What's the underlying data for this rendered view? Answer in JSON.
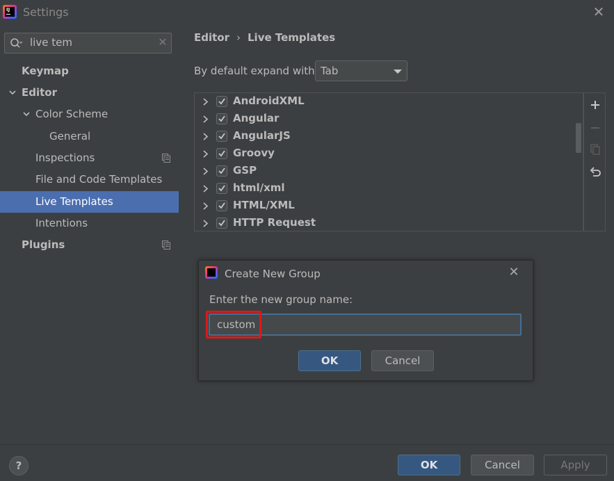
{
  "window": {
    "title": "Settings"
  },
  "search": {
    "value": "live tem"
  },
  "sidebar": {
    "items": [
      {
        "label": "Keymap"
      },
      {
        "label": "Editor"
      },
      {
        "label": "Color Scheme"
      },
      {
        "label": "General"
      },
      {
        "label": "Inspections"
      },
      {
        "label": "File and Code Templates"
      },
      {
        "label": "Live Templates"
      },
      {
        "label": "Intentions"
      },
      {
        "label": "Plugins"
      }
    ]
  },
  "breadcrumb": {
    "part1": "Editor",
    "separator": "›",
    "part2": "Live Templates"
  },
  "expand": {
    "label": "By default expand with",
    "value": "Tab"
  },
  "templates": {
    "groups": [
      {
        "name": "AndroidXML",
        "checked": true
      },
      {
        "name": "Angular",
        "checked": true
      },
      {
        "name": "AngularJS",
        "checked": true
      },
      {
        "name": "Groovy",
        "checked": true
      },
      {
        "name": "GSP",
        "checked": true
      },
      {
        "name": "html/xml",
        "checked": true
      },
      {
        "name": "HTML/XML",
        "checked": true
      },
      {
        "name": "HTTP Request",
        "checked": true
      }
    ]
  },
  "dialog": {
    "title": "Create New Group",
    "prompt": "Enter the new group name:",
    "input_value": "custom",
    "ok_label": "OK",
    "cancel_label": "Cancel"
  },
  "footer": {
    "help_label": "?",
    "ok_label": "OK",
    "cancel_label": "Cancel",
    "apply_label": "Apply"
  },
  "colors": {
    "background": "#3c3f41",
    "selection": "#4b6eaf",
    "primary_button": "#365880",
    "highlight": "#e01818"
  }
}
